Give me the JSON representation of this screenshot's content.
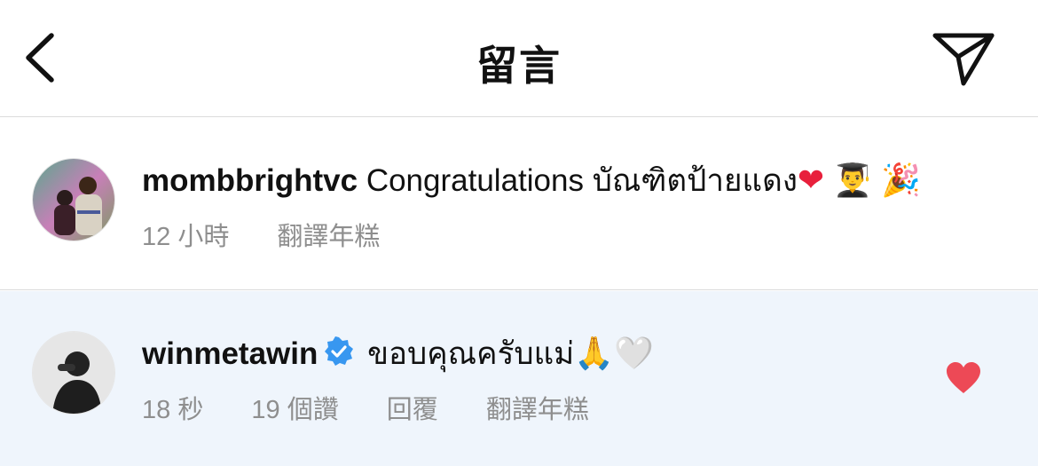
{
  "header": {
    "title": "留言",
    "back_icon": "chevron-left-icon",
    "send_icon": "paper-plane-icon"
  },
  "comments": [
    {
      "username": "mombbrightvc",
      "text": "Congratulations บัณฑิตป้ายแดง",
      "emojis": [
        "❤",
        "👨‍🎓",
        "🎉"
      ],
      "time": "12 小時",
      "translate": "翻譯年糕"
    },
    {
      "username": "winmetawin",
      "verified": true,
      "text": "ขอบคุณครับแม่",
      "emojis": [
        "🙏",
        "🤍"
      ],
      "time": "18 秒",
      "likes": "19 個讚",
      "reply": "回覆",
      "translate": "翻譯年糕",
      "liked": true
    }
  ],
  "colors": {
    "accent_like": "#ed4956",
    "verified_blue": "#3897f0",
    "highlight_bg": "#eff5fc",
    "meta_gray": "#8e8e8e"
  }
}
